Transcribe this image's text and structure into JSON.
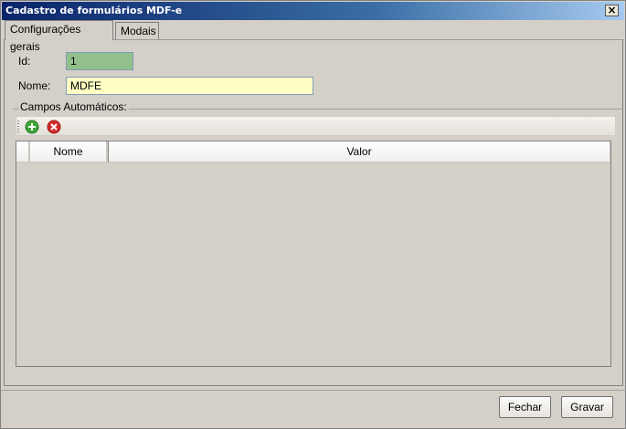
{
  "window": {
    "title": "Cadastro de formulários MDF-e",
    "close_label": "×"
  },
  "tabs": [
    {
      "label": "Configurações gerais",
      "active": true
    },
    {
      "label": "Modais",
      "active": false
    }
  ],
  "form": {
    "id_label": "Id:",
    "id_value": "1",
    "name_label": "Nome:",
    "name_value": "MDFE"
  },
  "group": {
    "label": "Campos Automáticos:"
  },
  "toolbar": {
    "add_icon": "add-icon",
    "remove_icon": "remove-icon"
  },
  "grid": {
    "columns": [
      "Nome",
      "Valor"
    ],
    "rows": []
  },
  "footer": {
    "close_label": "Fechar",
    "save_label": "Gravar"
  },
  "colors": {
    "id_bg": "#92c08a",
    "name_bg": "#ffffc4",
    "title_bg": "#0a246a"
  }
}
